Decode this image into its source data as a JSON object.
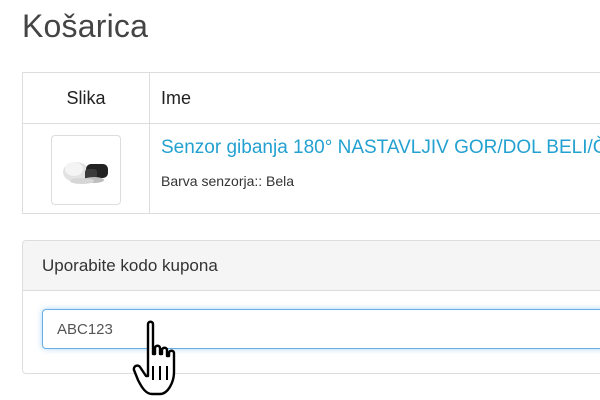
{
  "page": {
    "title": "Košarica"
  },
  "cart": {
    "headers": {
      "image": "Slika",
      "name": "Ime"
    },
    "items": [
      {
        "name": "Senzor gibanja 180° NASTAVLJIV GOR/DOL BELI/Č",
        "option": "Barva senzorja:: Bela",
        "image": "motion-sensor-product-icon"
      }
    ]
  },
  "coupon": {
    "heading": "Uporabite kodo kupona",
    "value": "ABC123"
  },
  "cursor": {
    "type": "hand-pointer-icon"
  },
  "colors": {
    "link": "#23a1d1",
    "focus_border": "#66afe9",
    "border": "#dddddd",
    "panel_heading_bg": "#f5f5f5"
  }
}
